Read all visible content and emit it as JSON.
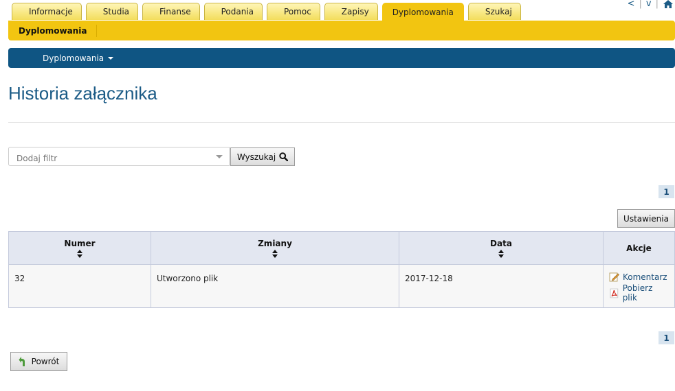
{
  "toplinks": {
    "prev": "<",
    "next": "v",
    "separator": "|"
  },
  "tabs": [
    {
      "label": "Informacje",
      "active": false
    },
    {
      "label": "Studia",
      "active": false
    },
    {
      "label": "Finanse",
      "active": false
    },
    {
      "label": "Podania",
      "active": false
    },
    {
      "label": "Pomoc",
      "active": false
    },
    {
      "label": "Zapisy",
      "active": false
    },
    {
      "label": "Dyplomowania",
      "active": true
    },
    {
      "label": "Szukaj",
      "active": false
    }
  ],
  "submenu": {
    "item": "Dyplomowania"
  },
  "navbar": {
    "menu_label": "Dyplomowania"
  },
  "page": {
    "title": "Historia załącznika"
  },
  "filter": {
    "placeholder": "Dodaj filtr",
    "search_label": "Wyszukaj"
  },
  "pagination": {
    "current": "1"
  },
  "settings_label": "Ustawienia",
  "table": {
    "columns": [
      "Numer",
      "Zmiany",
      "Data",
      "Akcje"
    ],
    "rows": [
      {
        "numer": "32",
        "zmiany": "Utworzono plik",
        "data": "2017-12-18",
        "actions": [
          "Komentarz",
          "Pobierz plik"
        ]
      }
    ]
  },
  "back_label": "Powrót",
  "colors": {
    "yellow": "#f2c511",
    "blue": "#0f5583",
    "title": "#1b5b86",
    "link": "#1b4f7a"
  }
}
